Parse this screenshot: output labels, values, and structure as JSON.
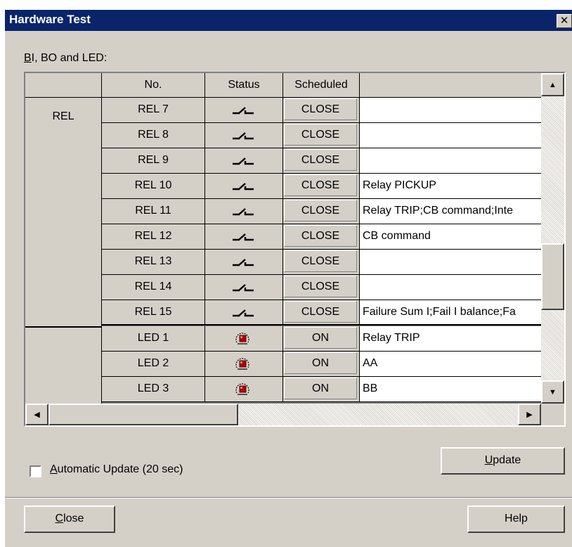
{
  "window": {
    "title": "Hardware Test",
    "close_glyph": "✕"
  },
  "group_label": {
    "accel": "B",
    "rest": "I, BO and LED:"
  },
  "grid": {
    "headers": {
      "blank": "",
      "no": "No.",
      "status": "Status",
      "scheduled": "Scheduled",
      "function": ""
    },
    "groups": [
      "REL",
      ""
    ],
    "rows": [
      {
        "no": "REL 7",
        "status_icon": "relay-switch-icon",
        "scheduled": "CLOSE",
        "function": ""
      },
      {
        "no": "REL 8",
        "status_icon": "relay-switch-icon",
        "scheduled": "CLOSE",
        "function": ""
      },
      {
        "no": "REL 9",
        "status_icon": "relay-switch-icon",
        "scheduled": "CLOSE",
        "function": ""
      },
      {
        "no": "REL 10",
        "status_icon": "relay-switch-icon",
        "scheduled": "CLOSE",
        "function": "Relay PICKUP"
      },
      {
        "no": "REL 11",
        "status_icon": "relay-switch-icon",
        "scheduled": "CLOSE",
        "function": "Relay TRIP;CB command;Inte"
      },
      {
        "no": "REL 12",
        "status_icon": "relay-switch-icon",
        "scheduled": "CLOSE",
        "function": "CB command"
      },
      {
        "no": "REL 13",
        "status_icon": "relay-switch-icon",
        "scheduled": "CLOSE",
        "function": ""
      },
      {
        "no": "REL 14",
        "status_icon": "relay-switch-icon",
        "scheduled": "CLOSE",
        "function": ""
      },
      {
        "no": "REL 15",
        "status_icon": "relay-switch-icon",
        "scheduled": "CLOSE",
        "function": "Failure Sum I;Fail I balance;Fa"
      },
      {
        "no": "LED 1",
        "status_icon": "led-icon",
        "scheduled": "ON",
        "function": "Relay TRIP"
      },
      {
        "no": "LED 2",
        "status_icon": "led-icon",
        "scheduled": "ON",
        "function": "AA"
      },
      {
        "no": "LED 3",
        "status_icon": "led-icon",
        "scheduled": "ON",
        "function": "BB"
      }
    ]
  },
  "auto_update": {
    "checked": false,
    "accel": "A",
    "rest": "utomatic Update (20 sec)"
  },
  "buttons": {
    "update": {
      "accel": "U",
      "rest": "pdate"
    },
    "close": {
      "accel": "C",
      "rest": "lose"
    },
    "help": {
      "label": "Help"
    }
  },
  "colors": {
    "titlebar": "#0a246a",
    "face": "#d4d0c8",
    "led_red": "#b00000"
  }
}
